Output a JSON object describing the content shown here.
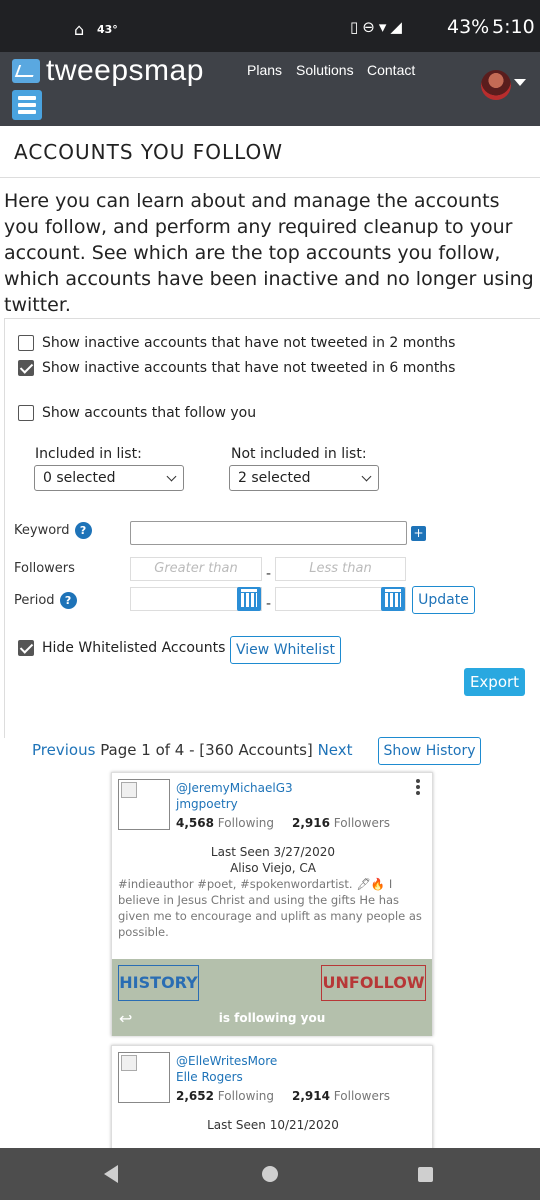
{
  "status_bar": {
    "temperature": "43°",
    "battery": "43%",
    "time": "5:10"
  },
  "header": {
    "logo_text": "tweepsmap",
    "nav": [
      "Plans",
      "Solutions",
      "Contact"
    ]
  },
  "page": {
    "title": "ACCOUNTS YOU FOLLOW",
    "intro": "Here you can learn about and manage the accounts you follow, and perform any required cleanup to your account. See which are the top accounts you follow, which accounts have been inactive and no longer using twitter."
  },
  "filters": {
    "inactive_2m": {
      "label": "Show inactive accounts that have not tweeted in 2 months",
      "checked": false
    },
    "inactive_6m": {
      "label": "Show inactive accounts that have not tweeted in 6 months",
      "checked": true
    },
    "follow_you": {
      "label": "Show accounts that follow you",
      "checked": false
    },
    "included_label": "Included in list:",
    "included_value": "0 selected",
    "not_included_label": "Not included in list:",
    "not_included_value": "2 selected",
    "keyword_label": "Keyword",
    "keyword_value": "",
    "followers_label": "Followers",
    "greater_placeholder": "Greater than",
    "less_placeholder": "Less than",
    "period_label": "Period",
    "update_label": "Update",
    "hide_whitelisted": {
      "label": "Hide Whitelisted Accounts",
      "checked": true
    },
    "view_whitelist_label": "View Whitelist",
    "export_label": "Export",
    "help_glyph": "?",
    "plus_glyph": "+",
    "dash": "-"
  },
  "pagination": {
    "previous": "Previous",
    "info": "Page 1 of 4 - [360 Accounts]",
    "next": "Next",
    "show_history": "Show History"
  },
  "accounts": [
    {
      "handle": "@JeremyMichaelG3",
      "name": "jmgpoetry",
      "following": "4,568",
      "following_label": "Following",
      "followers": "2,916",
      "followers_label": "Followers",
      "last_seen": "Last Seen 3/27/2020",
      "location": "Aliso Viejo, CA",
      "bio": "#indieauthor #poet, #spokenwordartist. 🖋🔥 I believe in Jesus Christ and using the gifts He has given me to encourage and uplift as many people as possible.",
      "history_label": "HISTORY",
      "unfollow_label": "UNFOLLOW",
      "follow_status": "is following you"
    },
    {
      "handle": "@ElleWritesMore",
      "name": "Elle Rogers",
      "following": "2,652",
      "following_label": "Following",
      "followers": "2,914",
      "followers_label": "Followers",
      "last_seen": "Last Seen 10/21/2020"
    }
  ]
}
